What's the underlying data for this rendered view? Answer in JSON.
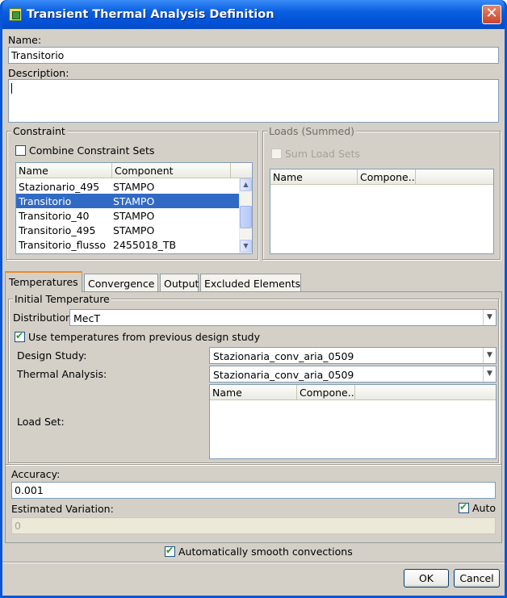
{
  "window": {
    "title": "Transient Thermal Analysis Definition"
  },
  "name": {
    "label": "Name:",
    "value": "Transitorio"
  },
  "description": {
    "label": "Description:",
    "value": ""
  },
  "constraint": {
    "title": "Constraint",
    "combine_label": "Combine Constraint Sets",
    "combine_checked": false,
    "columns": [
      "Name",
      "Component"
    ],
    "rows": [
      {
        "name": "Stazionario_495",
        "component": "STAMPO"
      },
      {
        "name": "Transitorio",
        "component": "STAMPO"
      },
      {
        "name": "Transitorio_40",
        "component": "STAMPO"
      },
      {
        "name": "Transitorio_495",
        "component": "STAMPO"
      },
      {
        "name": "Transitorio_flusso",
        "component": "2455018_TB"
      }
    ],
    "selected_index": 1
  },
  "loads": {
    "title": "Loads (Summed)",
    "sum_label": "Sum Load Sets",
    "sum_checked": false,
    "columns": [
      "Name",
      "Compone..."
    ]
  },
  "tabs": [
    "Temperatures",
    "Convergence",
    "Output",
    "Excluded Elements"
  ],
  "active_tab": 0,
  "initial_temperature": {
    "title": "Initial Temperature",
    "distribution_label": "Distribution",
    "distribution_value": "MecT",
    "use_prev_label": "Use temperatures from previous design study",
    "use_prev_checked": true,
    "design_study_label": "Design Study:",
    "design_study_value": "Stazionaria_conv_aria_0509",
    "thermal_analysis_label": "Thermal Analysis:",
    "thermal_analysis_value": "Stazionaria_conv_aria_0509",
    "load_set_label": "Load Set:",
    "load_set_columns": [
      "Name",
      "Compone..."
    ]
  },
  "accuracy": {
    "label": "Accuracy:",
    "value": "0.001"
  },
  "estimated_variation": {
    "label": "Estimated Variation:",
    "auto_label": "Auto",
    "auto_checked": true,
    "value": "0"
  },
  "smooth": {
    "label": "Automatically smooth convections",
    "checked": true
  },
  "buttons": {
    "ok": "OK",
    "cancel": "Cancel"
  },
  "colors": {
    "title_bar": "#0a56d8",
    "selection": "#316ac5",
    "dialog_bg": "#d4d0c8"
  }
}
